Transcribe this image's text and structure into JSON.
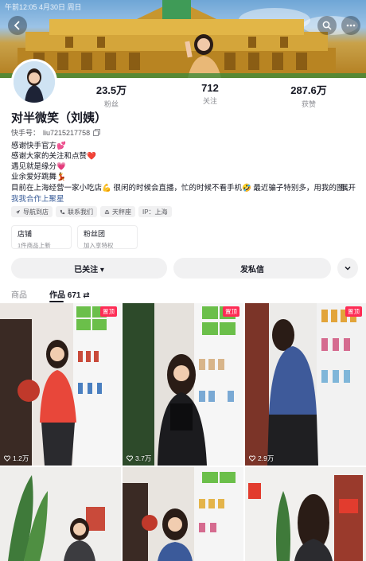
{
  "status": {
    "time_text": "午前12:05 4月30日 周日"
  },
  "profile": {
    "name": "对半微笑（刘姨）",
    "uid_label": "快手号：",
    "uid_value": "liu7215217758",
    "stats": [
      {
        "value": "23.5万",
        "label": "粉丝"
      },
      {
        "value": "712",
        "label": "关注"
      },
      {
        "value": "287.6万",
        "label": "获赞"
      }
    ],
    "bio_lines": [
      "感谢快手官方💕",
      "感谢大家的关注和点赞❤️",
      "遇见就是缘分💗",
      "业余爱好跳舞💃"
    ],
    "bio_long": "目前在上海经营一家小吃店💪 很闲的时候会直播，忙的时候不看手机🤣 最近骗子特别多，用我的图...",
    "bio_more": "展开",
    "link_text": "我我合作上聚星",
    "tags": [
      "导航到店",
      "联系我们",
      "天秤座",
      "IP：上海"
    ]
  },
  "cards": [
    {
      "title": "店铺",
      "sub": "1件商品上新"
    },
    {
      "title": "粉丝团",
      "sub": "加入享特权"
    }
  ],
  "actions": {
    "follow_label": "已关注 ▾",
    "message_label": "发私信"
  },
  "tabs": [
    {
      "label": "商品"
    },
    {
      "label": "作品 671 ⇄"
    }
  ],
  "videos": [
    {
      "likes": "1.2万",
      "badge": "置顶"
    },
    {
      "likes": "3.7万",
      "badge": "置顶"
    },
    {
      "likes": "2.9万",
      "badge": "置顶"
    },
    {
      "likes": "",
      "badge": ""
    },
    {
      "likes": "",
      "badge": ""
    },
    {
      "likes": "",
      "badge": ""
    }
  ],
  "colors": {
    "accent": "#fe2c55",
    "link": "#3a5d99",
    "muted": "#8a8b91"
  }
}
